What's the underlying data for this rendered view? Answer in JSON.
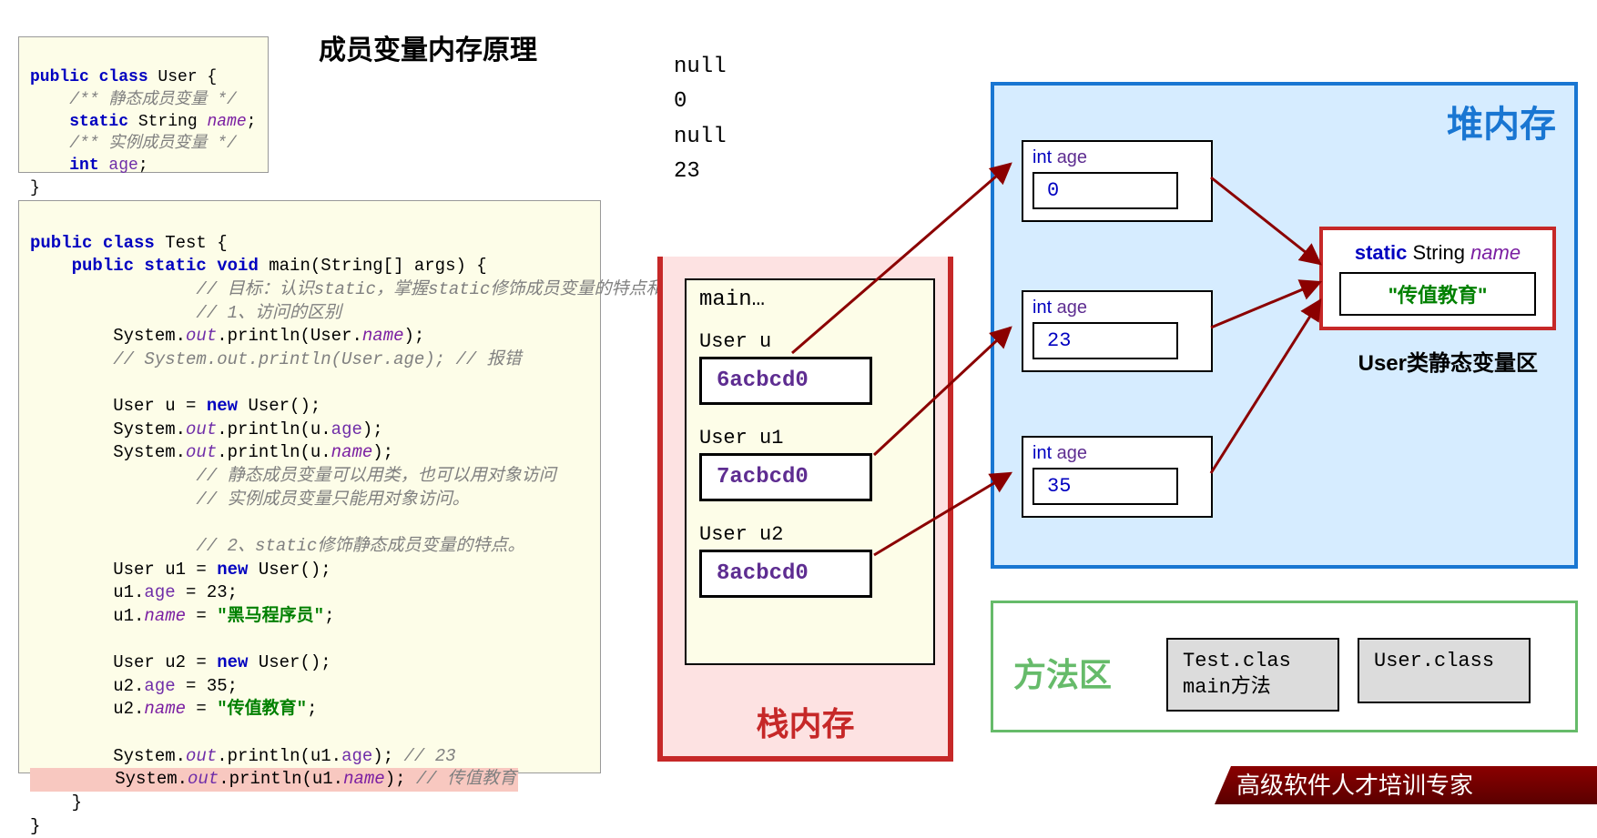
{
  "title": "成员变量内存原理",
  "code_user": {
    "l1_kw": "public class",
    "l1_cls": " User {",
    "l2_com": "/** 静态成员变量 */",
    "l3_kw": "static",
    "l3_ty": " String ",
    "l3_nm": "name",
    "l3_end": ";",
    "l4_com": "/** 实例成员变量 */",
    "l5_kw": "int",
    "l5_nm": " age",
    "l5_end": ";",
    "l6": "}"
  },
  "code_test": {
    "l1": "public class Test {",
    "l2": "    public static void main(String[] args) {",
    "l3": "        // 目标：认识static，掌握static修饰成员变量的特点和使用场景。",
    "l4": "        // 1、访问的区别",
    "l5": "        System.out.println(User.name);",
    "l6": "    // System.out.println(User.age); // 报错",
    "l7": "        User u = new User();",
    "l8": "        System.out.println(u.age);",
    "l9": "        System.out.println(u.name);",
    "l10": "        // 静态成员变量可以用类，也可以用对象访问",
    "l11": "        // 实例成员变量只能用对象访问。",
    "l12": "        // 2、static修饰静态成员变量的特点。",
    "l13": "        User u1 = new User();",
    "l14": "        u1.age = 23;",
    "l15": "        u1.name = \"黑马程序员\";",
    "l16": "        User u2 = new User();",
    "l17": "        u2.age = 35;",
    "l18": "        u2.name = \"传值教育\";",
    "l19": "        System.out.println(u1.age); // 23",
    "l20": "        System.out.println(u1.name); // 传值教育",
    "l21": "    }",
    "l22": "}"
  },
  "output": {
    "o1": "null",
    "o2": "0",
    "o3": "null",
    "o4": "23"
  },
  "stack": {
    "title": "栈内存",
    "frame": "main…",
    "vars": [
      {
        "label": "User u",
        "addr": "6acbcd0"
      },
      {
        "label": "User u1",
        "addr": "7acbcd0"
      },
      {
        "label": "User u2",
        "addr": "8acbcd0"
      }
    ]
  },
  "heap": {
    "title": "堆内存",
    "objects": [
      {
        "label": "int age",
        "value": "0"
      },
      {
        "label": "int age",
        "value": "23"
      },
      {
        "label": "int age",
        "value": "35"
      }
    ],
    "static_box": {
      "decl": "static String name",
      "value": "\"传值教育\"",
      "caption": "User类静态变量区"
    }
  },
  "method_area": {
    "title": "方法区",
    "box1_l1": "Test.clas",
    "box1_l2": "main方法",
    "box2": "User.class"
  },
  "footer": "高级软件人才培训专家"
}
